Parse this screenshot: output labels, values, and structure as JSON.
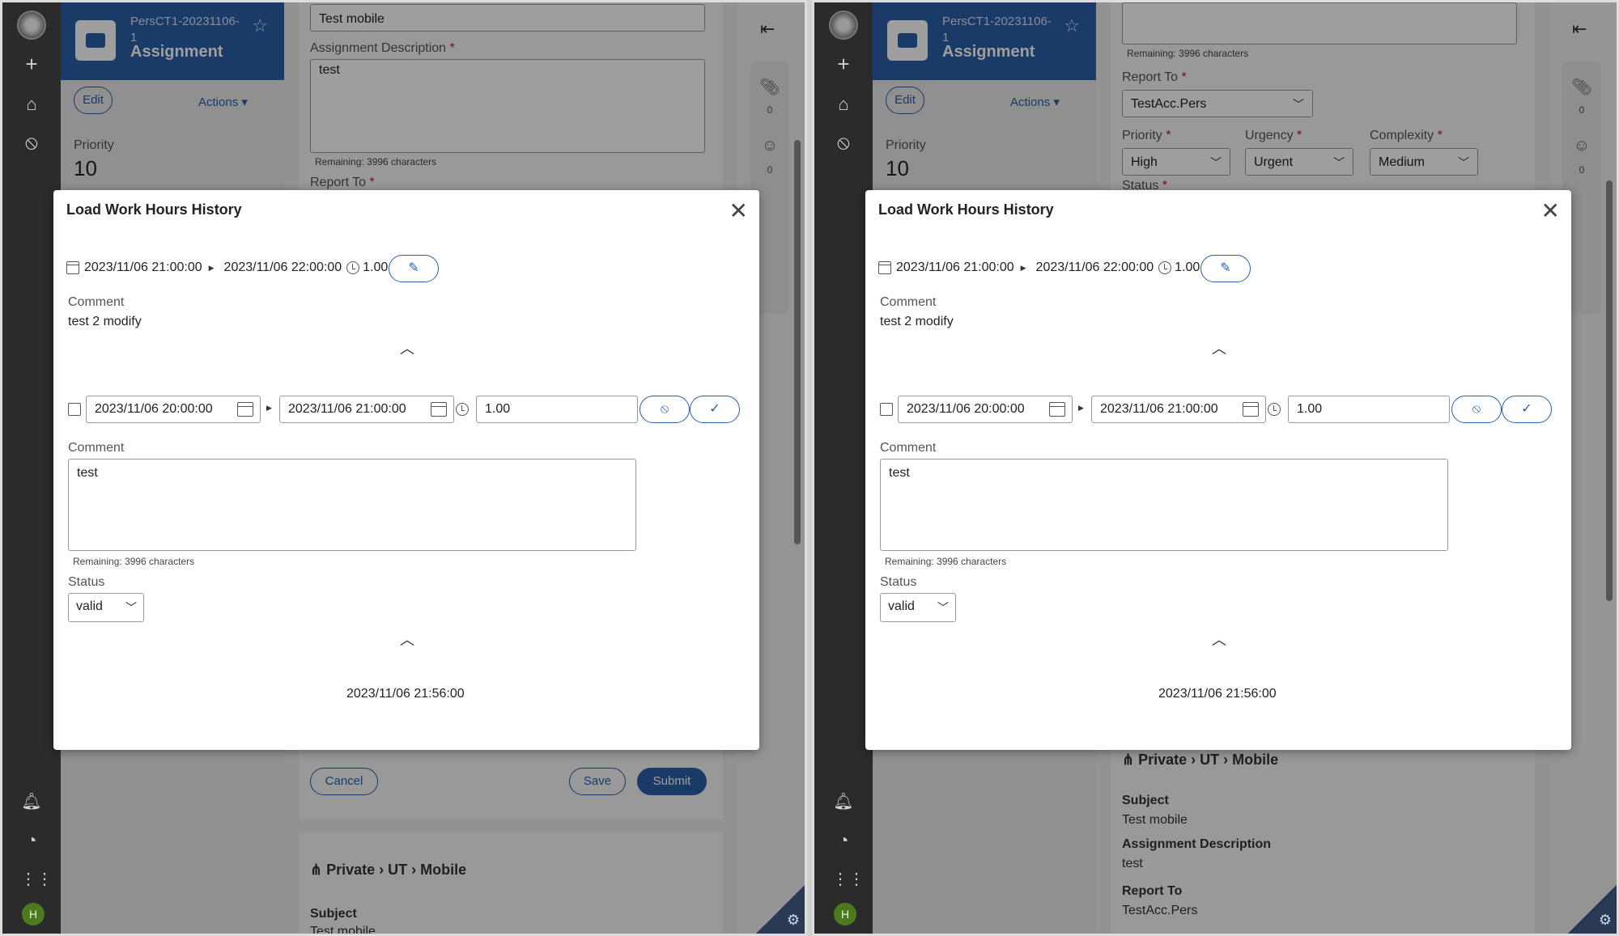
{
  "case": {
    "id": "PersCT1-20231106-1",
    "type": "Assignment",
    "edit_label": "Edit",
    "actions_label": "Actions",
    "priority_label": "Priority",
    "priority_value": "10"
  },
  "form_left": {
    "subject_value": "Test mobile",
    "desc_label": "Assignment Description",
    "desc_value": "test",
    "remaining": "Remaining: 3996 characters",
    "report_to_label": "Report To",
    "cancel_label": "Cancel",
    "save_label": "Save",
    "submit_label": "Submit",
    "crumb": [
      "Private",
      "UT",
      "Mobile"
    ],
    "subject_label": "Subject",
    "subject_text": "Test mobile"
  },
  "form_right": {
    "remaining": "Remaining: 3996 characters",
    "report_to_label": "Report To",
    "report_to_value": "TestAcc.Pers",
    "priority_label": "Priority",
    "priority_value": "High",
    "urgency_label": "Urgency",
    "urgency_value": "Urgent",
    "complexity_label": "Complexity",
    "complexity_value": "Medium",
    "status_label": "Status",
    "crumb": [
      "Private",
      "UT",
      "Mobile"
    ],
    "subject_label": "Subject",
    "subject_text": "Test mobile",
    "desc_label": "Assignment Description",
    "desc_text": "test",
    "report_to_text": "TestAcc.Pers"
  },
  "util": {
    "attachments_count": "0",
    "followers_count": "0"
  },
  "avatar_initial": "H",
  "modal": {
    "title": "Load Work Hours History",
    "entry": {
      "start": "2023/11/06 21:00:00",
      "end": "2023/11/06 22:00:00",
      "hours": "1.00",
      "comment_label": "Comment",
      "comment": "test 2 modify"
    },
    "edit": {
      "start": "2023/11/06 20:00:00",
      "end": "2023/11/06 21:00:00",
      "hours": "1.00",
      "comment_label": "Comment",
      "comment": "test",
      "remaining": "Remaining: 3996 characters",
      "status_label": "Status",
      "status_value": "valid"
    },
    "timestamp": "2023/11/06 21:56:00"
  },
  "icons": {
    "collapse": "collapse-panel-icon",
    "close": "close-icon",
    "pencil": "pencil-icon",
    "cancel": "cancel-icon",
    "check": "check-icon"
  }
}
